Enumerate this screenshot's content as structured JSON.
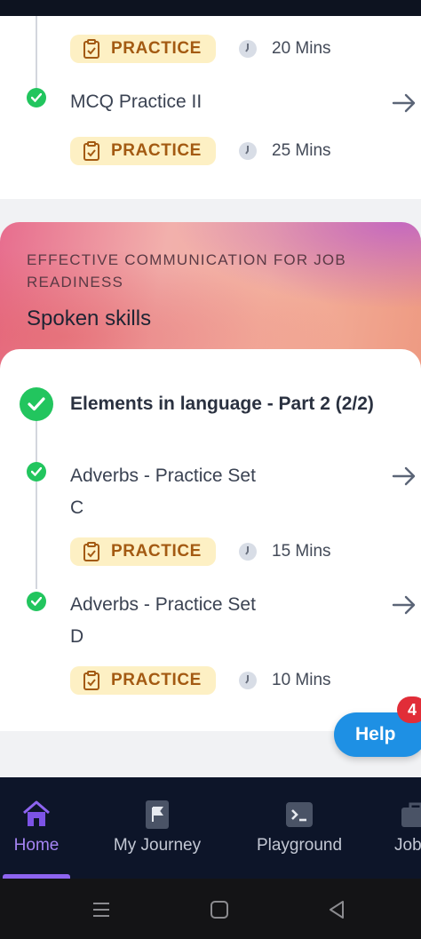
{
  "upper_list": {
    "items": [
      {
        "badge": "PRACTICE",
        "duration": "20 Mins"
      },
      {
        "title": "MCQ Practice II",
        "badge": "PRACTICE",
        "duration": "25 Mins"
      }
    ]
  },
  "module": {
    "eyebrow": "EFFECTIVE COMMUNICATION FOR JOB READINESS",
    "heading": "Spoken skills",
    "section_title": "Elements in language - Part 2 (2/2)",
    "items": [
      {
        "title_line1": "Adverbs - Practice Set",
        "title_line2": "C",
        "badge": "PRACTICE",
        "duration": "15 Mins"
      },
      {
        "title_line1": "Adverbs - Practice Set",
        "title_line2": "D",
        "badge": "PRACTICE",
        "duration": "10 Mins"
      }
    ]
  },
  "help": {
    "label": "Help",
    "count": "4"
  },
  "nav": {
    "items": [
      {
        "label": "Home",
        "icon": "home-icon",
        "active": true
      },
      {
        "label": "My Journey",
        "icon": "flag-file-icon"
      },
      {
        "label": "Playground",
        "icon": "terminal-icon"
      },
      {
        "label": "Job",
        "icon": "briefcase-icon"
      }
    ]
  },
  "colors": {
    "success": "#22c55e",
    "badge_bg": "#fdf0c4",
    "badge_text": "#a35a12",
    "help": "#1e90e4",
    "nav_bg": "#0d1529",
    "nav_active": "#a584f3"
  }
}
